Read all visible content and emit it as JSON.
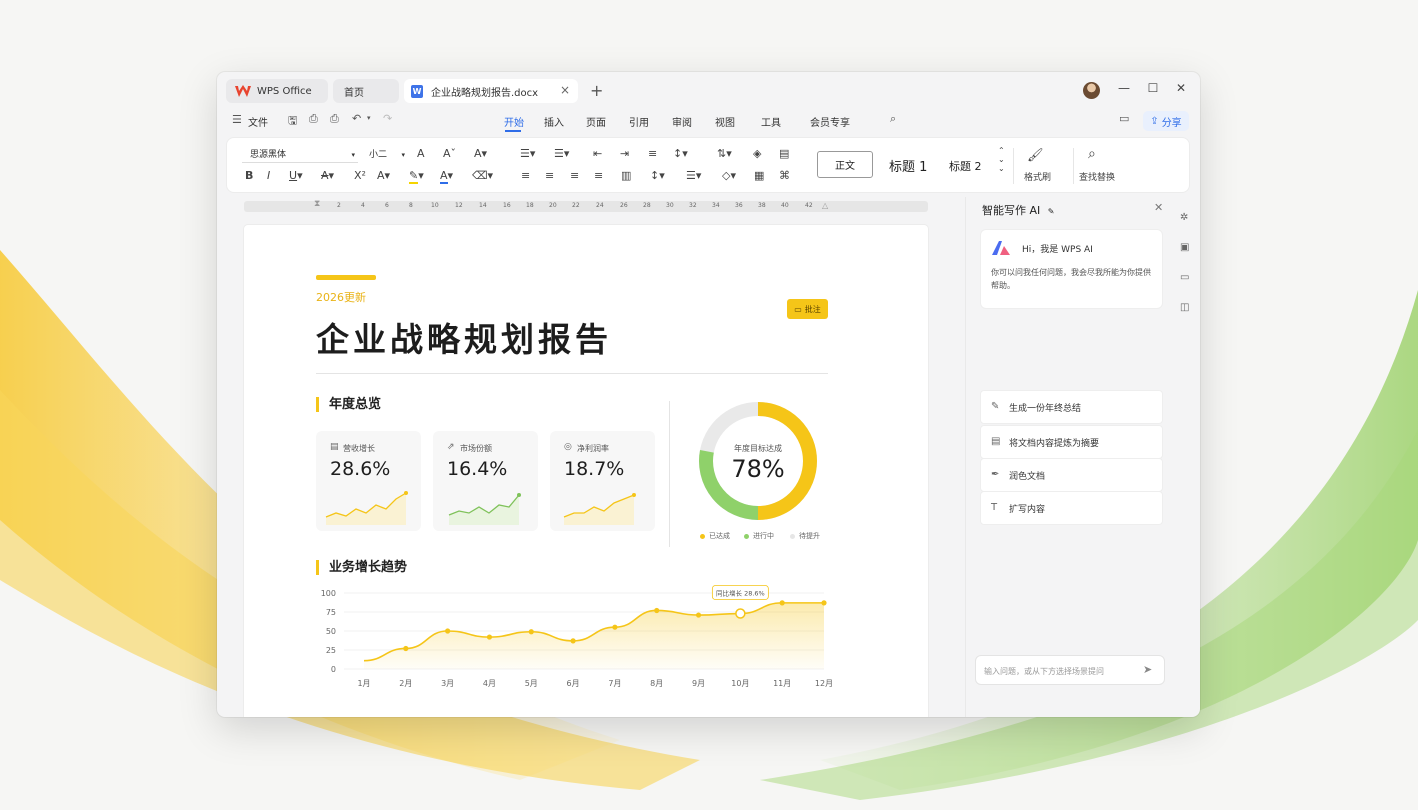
{
  "window": {
    "tabs": [
      {
        "label": "WPS Office"
      },
      {
        "label": "首页"
      },
      {
        "label": "企业战略规划报告.docx"
      }
    ]
  },
  "menu": {
    "file": "文件",
    "items": [
      "开始",
      "插入",
      "页面",
      "引用",
      "审阅",
      "视图",
      "工具",
      "会员专享"
    ],
    "active": "开始",
    "share": "分享"
  },
  "ribbon": {
    "font": "思源黑体",
    "size": "小二",
    "styles": [
      "正文",
      "标题 1",
      "标题 2"
    ],
    "format_painter": "格式刷",
    "find_replace": "查找替换"
  },
  "ruler": {
    "ticks": [
      "2",
      "4",
      "6",
      "8",
      "10",
      "12",
      "14",
      "16",
      "18",
      "20",
      "22",
      "24",
      "26",
      "28",
      "30",
      "32",
      "34",
      "36",
      "38",
      "40",
      "42"
    ]
  },
  "document": {
    "update": "2026更新",
    "title": "企业战略规划报告",
    "comment_badge": "批注",
    "section_overview": "年度总览",
    "stats": [
      {
        "label": "营收增长",
        "value": "28.6%",
        "icon": "receipt-icon"
      },
      {
        "label": "市场份额",
        "value": "16.4%",
        "icon": "share-icon"
      },
      {
        "label": "净利润率",
        "value": "18.7%",
        "icon": "coin-icon"
      }
    ],
    "donut": {
      "label": "年度目标达成",
      "value": "78%",
      "achieved_fraction": 0.5,
      "in_progress_fraction": 0.28
    },
    "legend": [
      "已达成",
      "进行中",
      "待提升"
    ],
    "section_trend": "业务增长趋势",
    "colors": {
      "accent": "#f5c518",
      "green": "#8fd16a",
      "grey": "#e6e6e6"
    }
  },
  "chart_data": {
    "type": "area",
    "categories": [
      "1月",
      "2月",
      "3月",
      "4月",
      "5月",
      "6月",
      "7月",
      "8月",
      "9月",
      "10月",
      "11月",
      "12月"
    ],
    "values": [
      11,
      27,
      50,
      42,
      49,
      37,
      55,
      77,
      71,
      73,
      87,
      87
    ],
    "yticks": [
      "0",
      "25",
      "50",
      "75",
      "100"
    ],
    "ylim": [
      0,
      100
    ],
    "annotation": "同比增长 28.6%",
    "grid": true
  },
  "ai": {
    "title": "智能写作 AI",
    "greeting": "Hi，我是 WPS AI",
    "desc": "你可以问我任何问题，我会尽我所能为你提供帮助。",
    "options": [
      "生成一份年终总结",
      "将文档内容提炼为摘要",
      "润色文档",
      "扩写内容"
    ],
    "input_placeholder": "输入问题，或从下方选择场景提问"
  }
}
